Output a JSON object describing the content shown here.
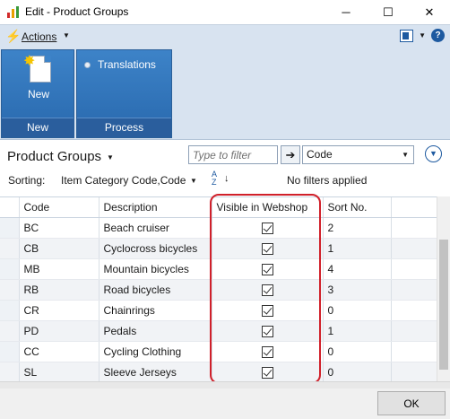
{
  "window": {
    "title": "Edit - Product Groups",
    "controls": {
      "minimize": "─",
      "maximize": "☐",
      "close": "✕"
    }
  },
  "actions_bar": {
    "label": "Actions",
    "help": "?"
  },
  "ribbon": {
    "groups": [
      {
        "caption": "New",
        "buttons": [
          {
            "label": "New",
            "icon": "new-document-icon"
          }
        ]
      },
      {
        "caption": "Process",
        "buttons": [
          {
            "label": "Translations",
            "icon": "translations-icon"
          }
        ]
      }
    ]
  },
  "page": {
    "title": "Product Groups",
    "filter_placeholder": "Type to filter",
    "filter_field": "Code",
    "sorting_label": "Sorting:",
    "sort_value": "Item Category Code,Code",
    "filter_status": "No filters applied"
  },
  "table": {
    "columns": [
      "Code",
      "Description",
      "Visible in Webshop",
      "Sort No."
    ],
    "rows": [
      {
        "code": "BC",
        "description": "Beach cruiser",
        "visible": true,
        "sort_no": "2"
      },
      {
        "code": "CB",
        "description": "Cyclocross bicycles",
        "visible": true,
        "sort_no": "1"
      },
      {
        "code": "MB",
        "description": "Mountain bicycles",
        "visible": true,
        "sort_no": "4"
      },
      {
        "code": "RB",
        "description": "Road bicycles",
        "visible": true,
        "sort_no": "3"
      },
      {
        "code": "CR",
        "description": "Chainrings",
        "visible": true,
        "sort_no": "0"
      },
      {
        "code": "PD",
        "description": "Pedals",
        "visible": true,
        "sort_no": "1"
      },
      {
        "code": "CC",
        "description": "Cycling Clothing",
        "visible": true,
        "sort_no": "0"
      },
      {
        "code": "SL",
        "description": "Sleeve Jerseys",
        "visible": true,
        "sort_no": "0"
      }
    ]
  },
  "footer": {
    "ok_label": "OK"
  },
  "colors": {
    "ribbon_blue": "#2f74ba",
    "highlight_red": "#d0202a",
    "accent": "#1e5aa0"
  }
}
